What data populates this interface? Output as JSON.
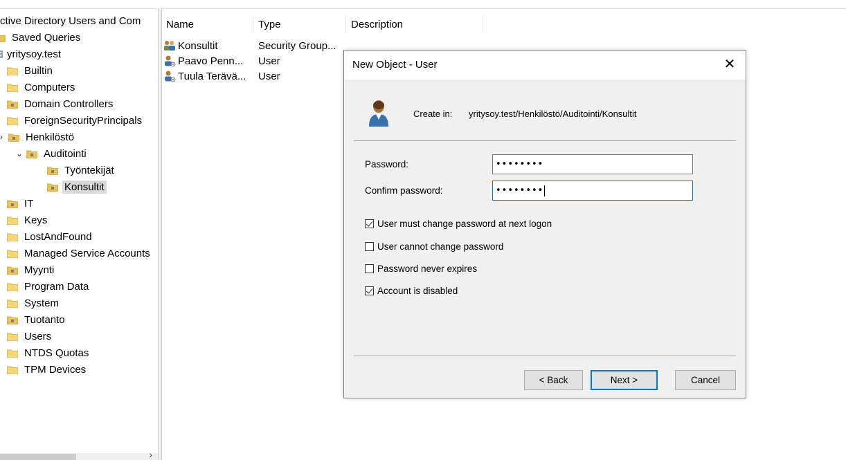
{
  "tree": {
    "root_label": "ctive Directory Users and Com",
    "items": [
      {
        "label": "Saved Queries"
      },
      {
        "label": "yritysoy.test"
      },
      {
        "label": "Builtin"
      },
      {
        "label": "Computers"
      },
      {
        "label": "Domain Controllers"
      },
      {
        "label": "ForeignSecurityPrincipals"
      },
      {
        "label": "Henkilöstö"
      },
      {
        "label": "Auditointi"
      },
      {
        "label": "Työntekijät"
      },
      {
        "label": "Konsultit"
      },
      {
        "label": "IT"
      },
      {
        "label": "Keys"
      },
      {
        "label": "LostAndFound"
      },
      {
        "label": "Managed Service Accounts"
      },
      {
        "label": "Myynti"
      },
      {
        "label": "Program Data"
      },
      {
        "label": "System"
      },
      {
        "label": "Tuotanto"
      },
      {
        "label": "Users"
      },
      {
        "label": "NTDS Quotas"
      },
      {
        "label": "TPM Devices"
      }
    ]
  },
  "list": {
    "columns": [
      "Name",
      "Type",
      "Description"
    ],
    "rows": [
      {
        "name": "Konsultit",
        "type": "Security Group..."
      },
      {
        "name": "Paavo Penn...",
        "type": "User"
      },
      {
        "name": "Tuula Terävä...",
        "type": "User"
      }
    ]
  },
  "dialog": {
    "title": "New Object - User",
    "create_in_label": "Create in:",
    "create_in_path": "yritysoy.test/Henkilöstö/Auditointi/Konsultit",
    "password_label": "Password:",
    "password_value": "••••••••",
    "confirm_label": "Confirm password:",
    "confirm_value": "••••••••",
    "checkboxes": [
      {
        "label": "User must change password at next logon",
        "checked": true
      },
      {
        "label": "User cannot change password",
        "checked": false
      },
      {
        "label": "Password never expires",
        "checked": false
      },
      {
        "label": "Account is disabled",
        "checked": true
      }
    ],
    "back_label": "< Back",
    "next_label": "Next >",
    "cancel_label": "Cancel",
    "close_glyph": "✕"
  },
  "tree_scroll_arrow": "›",
  "colors": {
    "accent": "#0078d7",
    "folder": "#e8c25a",
    "selection": "#d9d9d9"
  }
}
